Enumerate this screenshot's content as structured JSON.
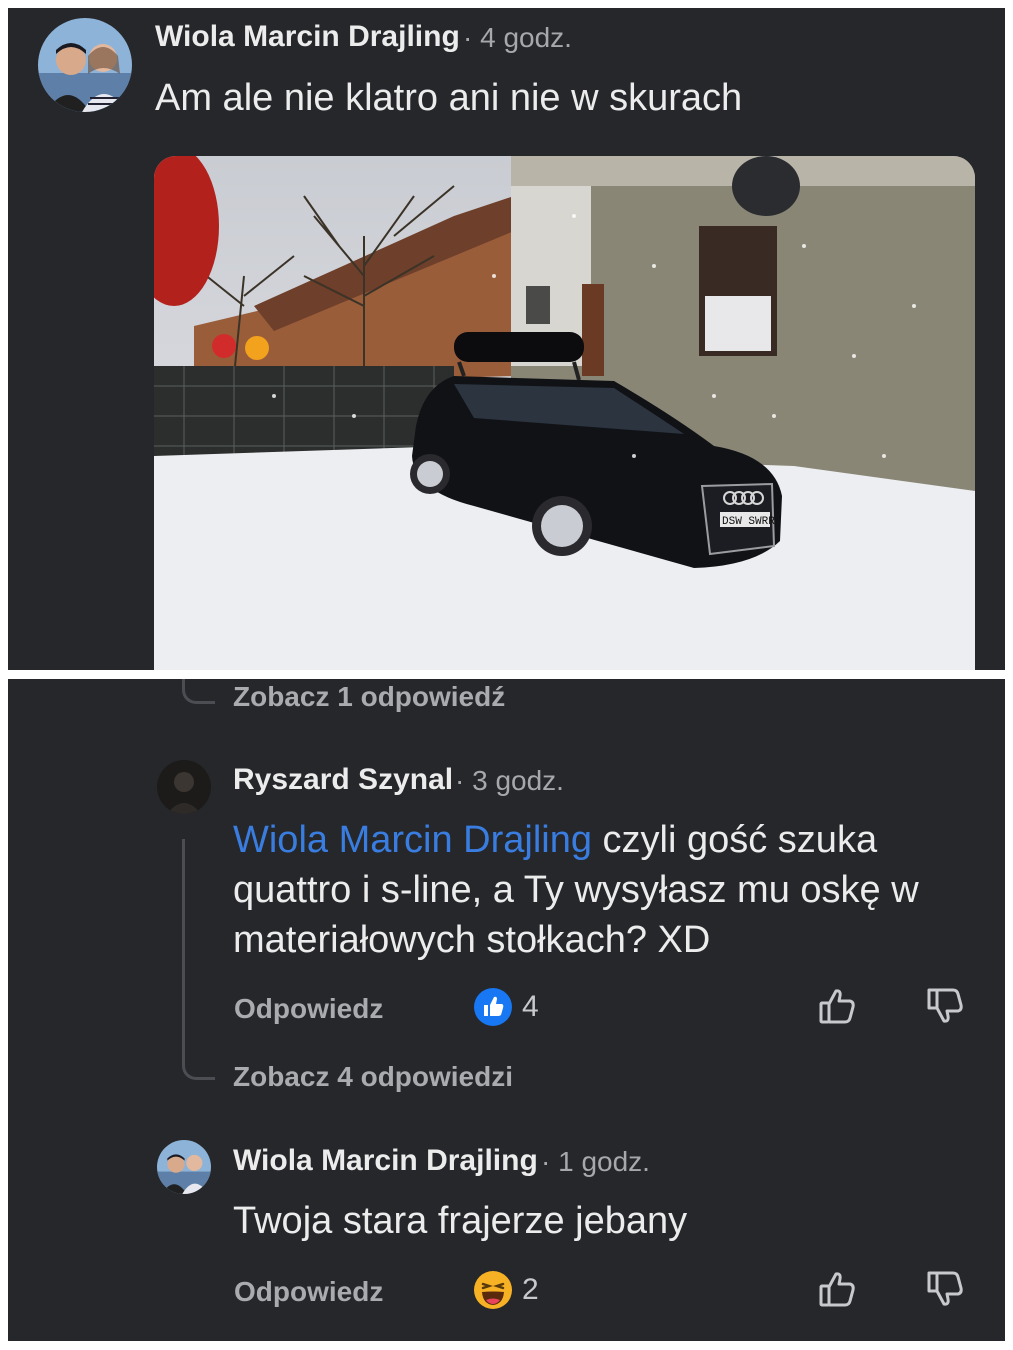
{
  "top_comment": {
    "author": "Wiola Marcin Drajling",
    "time": "· 4 godz.",
    "text": "Am ale nie klatro ani nie w skurach",
    "photo": {
      "icon": "car-photo",
      "plate": "DSW SWRR"
    }
  },
  "thread1": {
    "see_replies": "Zobacz 1 odpowiedź"
  },
  "reply1": {
    "author": "Ryszard Szynal",
    "time": "· 3 godz.",
    "mention": "Wiola Marcin Drajling",
    "text": " czyli gość szuka quattro i s-line, a Ty wysyłasz mu oskę w materiałowych stołkach? XD",
    "reply_label": "Odpowiedz",
    "reaction_icon": "like-reaction-icon",
    "reaction_count": "4",
    "see_replies": "Zobacz 4 odpowiedzi"
  },
  "reply2": {
    "author": "Wiola Marcin Drajling",
    "time": "· 1 godz.",
    "text": "Twoja stara frajerze jebany",
    "reply_label": "Odpowiedz",
    "reaction_icon": "haha-reaction-icon",
    "reaction_count": "2"
  },
  "colors": {
    "background": "#25272b",
    "text": "#ececec",
    "muted": "#a6a8ac",
    "mention": "#3a7de0",
    "like": "#1877f2",
    "haha": "#f7b125"
  }
}
